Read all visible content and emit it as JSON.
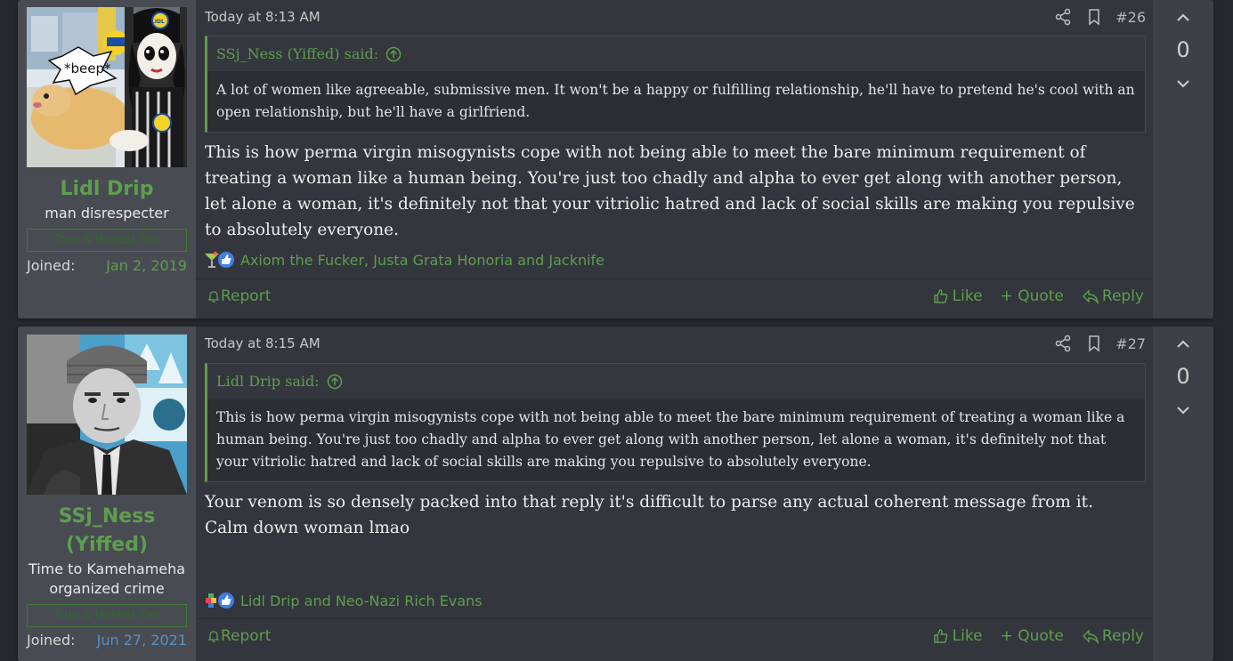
{
  "posts": [
    {
      "username": "Lidl Drip",
      "user_title": "man disrespecter",
      "badge": "True & Honest Fan",
      "joined_label": "Joined:",
      "joined_date": "Jan 2, 2019",
      "avatar_caption": "*beep*",
      "avatar_brand": "LIDL",
      "time": "Today at 8:13 AM",
      "post_number": "#26",
      "quote_author": "SSj_Ness (Yiffed) said:",
      "quote_text": "A lot of women like agreeable, submissive men. It won't be a happy or fulfilling relationship, he'll have to pretend he's cool with an open relationship, but he'll have a girlfriend.",
      "body": "This is how perma virgin misogynists cope with not being able to meet the bare minimum requirement of treating a woman like a human being. You're just too chadly and alpha to ever get along with another person, let alone a woman, it's definitely not that your vitriolic hatred and lack of social skills are making you repulsive to absolutely everyone.",
      "reactions_text": "Axiom the Fucker, Justa Grata Honoria and Jacknife",
      "report_label": "Report",
      "like_label": "Like",
      "quote_label": "+ Quote",
      "reply_label": "Reply",
      "vote_count": "0"
    },
    {
      "username": "SSj_Ness (Yiffed)",
      "user_title": "Time to Kamehameha organized crime",
      "badge": "True & Honest Fan",
      "joined_label": "Joined:",
      "joined_date": "Jun 27, 2021",
      "time": "Today at 8:15 AM",
      "post_number": "#27",
      "quote_author": "Lidl Drip said:",
      "quote_text": "This is how perma virgin misogynists cope with not being able to meet the bare minimum requirement of treating a woman like a human being. You're just too chadly and alpha to ever get along with another person, let alone a woman, it's definitely not that your vitriolic hatred and lack of social skills are making you repulsive to absolutely everyone.",
      "body": "Your venom is so densely packed into that reply it's difficult to parse any actual coherent message from it. Calm down woman lmao",
      "reactions_text": "Lidl Drip and Neo-Nazi Rich Evans",
      "report_label": "Report",
      "like_label": "Like",
      "quote_label": "+ Quote",
      "reply_label": "Reply",
      "vote_count": "0"
    }
  ],
  "colors": {
    "accent": "#5f9d4f",
    "background": "#26282d",
    "post_bg": "#33363c",
    "user_bg": "#484b52",
    "joined_blue": "#5a8fc4"
  }
}
